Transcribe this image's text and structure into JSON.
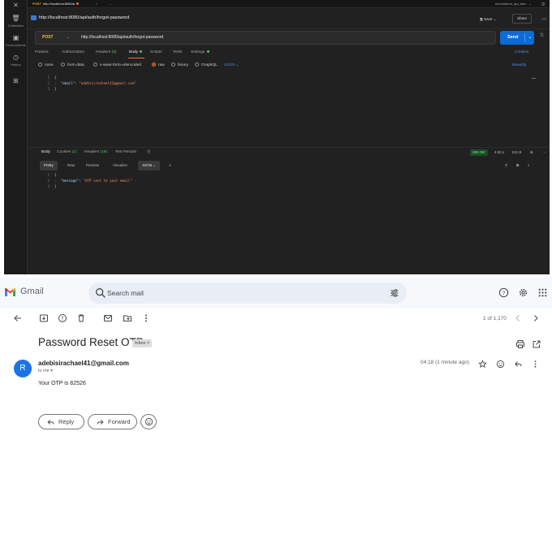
{
  "postman": {
    "rail": [
      {
        "icon": "collections-icon",
        "label": "Collections"
      },
      {
        "icon": "environments-icon",
        "label": "Environments"
      },
      {
        "icon": "history-icon",
        "label": "History"
      }
    ],
    "tab": {
      "method": "POST",
      "url": "http://localhost:8080/a"
    },
    "env_label": "ecommerce_api_test...",
    "title": "http://localhost:8080/api/auth/forgot-password",
    "save_label": "Save",
    "share_label": "Share",
    "request": {
      "method": "POST",
      "url": "http://localhost:8080/api/auth/forgot-password",
      "send_label": "Send"
    },
    "req_tabs": {
      "params": "Params",
      "authorization": "Authorization",
      "headers": "Headers",
      "headers_count": "(8)",
      "body": "Body",
      "scripts": "Scripts",
      "tests": "Tests",
      "settings": "Settings",
      "cookies": "Cookies"
    },
    "body_types": {
      "none": "none",
      "form_data": "form-data",
      "urlencoded": "x-www-form-urlencoded",
      "raw": "raw",
      "binary": "binary",
      "graphql": "GraphQL",
      "json": "JSON",
      "beautify": "Beautify"
    },
    "request_body": {
      "ln1": "1",
      "ln2": "2",
      "ln3": "3",
      "open": "{",
      "key": "\"email\"",
      "colon": ": ",
      "value": "\"adebisirachael41@gmail.com\"",
      "close": "}"
    },
    "resp_tabs": {
      "body": "Body",
      "cookies": "Cookies",
      "cookies_count": "(1)",
      "headers": "Headers",
      "headers_count": "(18)",
      "test_results": "Test Results"
    },
    "response_meta": {
      "status": "200 OK",
      "time": "4.50 s",
      "size": "611 B"
    },
    "resp_views": {
      "pretty": "Pretty",
      "raw": "Raw",
      "preview": "Preview",
      "visualize": "Visualize",
      "format": "JSON"
    },
    "response_body": {
      "ln1": "1",
      "ln2": "2",
      "ln3": "3",
      "open": "{",
      "key": "\"message\"",
      "colon": ": ",
      "value": "\"OTP sent to your email\"",
      "close": "}"
    }
  },
  "gmail": {
    "logo_text": "Gmail",
    "search_placeholder": "Search mail",
    "count": "1 of 1,170",
    "subject": "Password Reset OTP",
    "label": "Inbox ×",
    "avatar_letter": "R",
    "sender": "adebisirachael41@gmail.com",
    "to": "to me ▾",
    "time": "04:18 (1 minute ago)",
    "body": "Your OTP is 82526",
    "reply_label": "Reply",
    "forward_label": "Forward",
    "colors": {
      "header_bg": "#f6f8fc",
      "search_bg": "#e9eef6",
      "avatar_bg": "#1a73e8"
    }
  }
}
